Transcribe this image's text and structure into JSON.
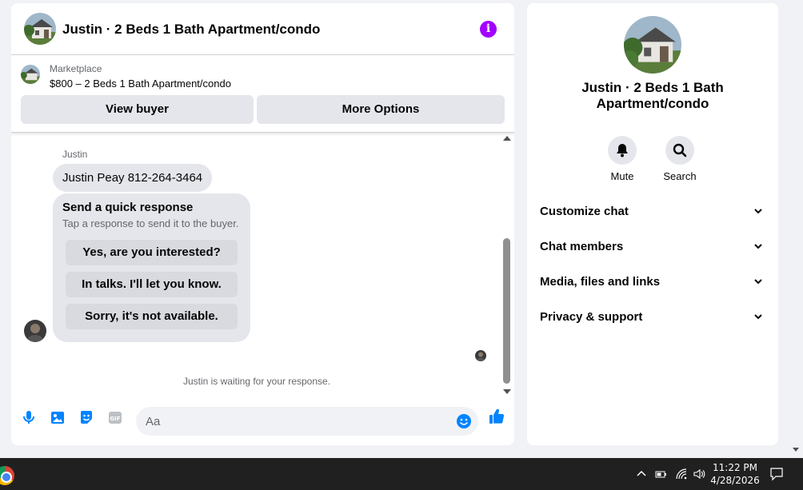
{
  "chat": {
    "title": "Justin · 2 Beds 1 Bath Apartment/condo",
    "info_icon": "i",
    "marketplace": {
      "label": "Marketplace",
      "listing": "$800 – 2 Beds 1 Bath Apartment/condo",
      "view_buyer_label": "View buyer",
      "more_options_label": "More Options"
    },
    "messages": {
      "sender_name": "Justin",
      "message_text": "Justin Peay 812-264-3464",
      "quick_response": {
        "title": "Send a quick response",
        "subtitle": "Tap a response to send it to the buyer.",
        "options": [
          "Yes, are you interested?",
          "In talks. I'll let you know.",
          "Sorry, it's not available."
        ]
      },
      "waiting_text": "Justin is waiting for your response."
    },
    "composer": {
      "placeholder": "Aa",
      "icons": [
        "microphone-icon",
        "photo-icon",
        "sticker-icon",
        "gif-icon",
        "emoji-icon",
        "thumbs-up-icon"
      ],
      "accent_color": "#0084ff"
    }
  },
  "details": {
    "title": "Justin · 2 Beds 1 Bath Apartment/condo",
    "actions": [
      {
        "label": "Mute",
        "icon": "bell-icon"
      },
      {
        "label": "Search",
        "icon": "search-icon"
      }
    ],
    "sections": [
      "Customize chat",
      "Chat members",
      "Media, files and links",
      "Privacy & support"
    ]
  },
  "taskbar": {
    "time": "11:22 PM",
    "date": "4/28/2026"
  }
}
